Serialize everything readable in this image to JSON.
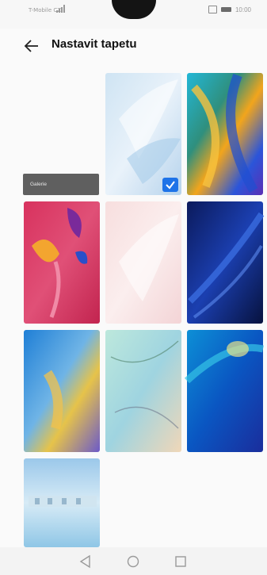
{
  "status_bar": {
    "carrier": "T-Mobile CZ",
    "time": "10:00",
    "icons": [
      "signal-icon",
      "nfc-icon",
      "battery-icon"
    ]
  },
  "header": {
    "back_icon": "arrow-left-icon",
    "title": "Nastavit tapetu"
  },
  "gallery_tile": {
    "label": "Galerie"
  },
  "wallpapers": [
    {
      "name": "white-petals",
      "selected": true
    },
    {
      "name": "aurora-multicolor",
      "selected": false
    },
    {
      "name": "pink-flower",
      "selected": false
    },
    {
      "name": "pink-petals",
      "selected": false
    },
    {
      "name": "dark-blue-waves",
      "selected": false
    },
    {
      "name": "blue-yellow-watercolor",
      "selected": false
    },
    {
      "name": "teal-marble",
      "selected": false
    },
    {
      "name": "blue-waves",
      "selected": false
    },
    {
      "name": "blue-landscape",
      "selected": false
    }
  ],
  "selected_icon": "checkmark-icon",
  "nav_bar": {
    "icons": [
      "back-triangle-icon",
      "home-circle-icon",
      "recents-square-icon"
    ]
  },
  "colors": {
    "accent": "#1e73e8",
    "gallery_bg": "#5f5f5f"
  }
}
